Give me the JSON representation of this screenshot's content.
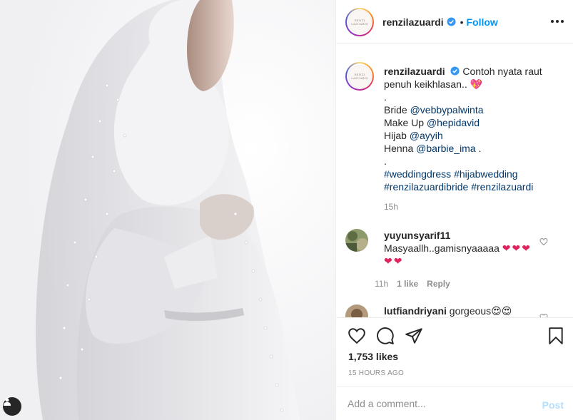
{
  "post": {
    "username": "renzilazuardi",
    "follow_label": "Follow",
    "separator": "•",
    "avatar_text": "RENZI LAZUARDI",
    "verified": true,
    "accent_color": "#0095f6"
  },
  "caption": {
    "username": "renzilazuardi",
    "text_line1": "Contoh nyata raut",
    "text_line2": "penuh keikhlasan..",
    "emoji": "💖",
    "dot1": ".",
    "bride_label": "Bride",
    "bride_tag": "@vebbypalwinta",
    "makeup_label": "Make Up",
    "makeup_tag": "@hepidavid",
    "hijab_label": "Hijab",
    "hijab_tag": "@ayyih",
    "henna_label": "Henna",
    "henna_tag": "@barbie_ima",
    "henna_dot": ".",
    "dot2": ".",
    "hashtag1": "#weddingdress",
    "hashtag2": "#hijabwedding",
    "hashtag3": "#renzilazuardibride",
    "hashtag4": "#renzilazuardi",
    "time": "15h"
  },
  "comments": [
    {
      "username": "yuyunsyarif11",
      "text": "Masyaallh..gamisnyaaaaa",
      "emojis_line1": "❤❤❤",
      "emojis_line2": "❤❤",
      "time": "11h",
      "likes": "1 like",
      "reply": "Reply"
    },
    {
      "username": "lutfiandriyani",
      "text": "gorgeous",
      "emojis": "😍😍"
    }
  ],
  "actions": {
    "likes": "1,753 likes",
    "posted_ago": "15 HOURS AGO"
  },
  "add_comment": {
    "placeholder": "Add a comment...",
    "post_label": "Post"
  }
}
